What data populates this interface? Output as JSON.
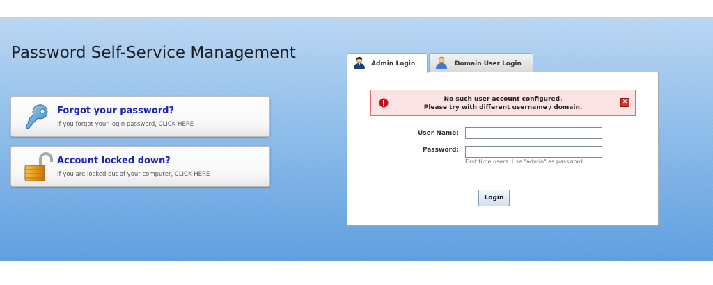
{
  "header": {
    "title": "Password Self-Service Management"
  },
  "actions": [
    {
      "title": "Forgot your password?",
      "subtitle": "If you forgot your login password, CLICK HERE",
      "icon": "key-icon"
    },
    {
      "title": "Account locked down?",
      "subtitle": "If you are locked out of your computer, CLICK HERE",
      "icon": "padlock-icon"
    }
  ],
  "login": {
    "tabs": [
      {
        "label": "Admin Login",
        "icon": "admin-user-icon",
        "active": true
      },
      {
        "label": "Domain User Login",
        "icon": "domain-user-icon",
        "active": false
      }
    ],
    "error": {
      "line1": "No such user account configured.",
      "line2": "Please try with different username / domain."
    },
    "username_label": "User Name:",
    "username_value": "",
    "password_label": "Password:",
    "password_value": "",
    "hint": "First time users: Use \"admin\" as password",
    "submit_label": "Login"
  },
  "colors": {
    "link_blue": "#1a23b8",
    "error_bg": "#fbe3e3",
    "error_border": "#e26b6b",
    "band_top": "#b9d6f2",
    "band_bottom": "#5e9ee0"
  }
}
